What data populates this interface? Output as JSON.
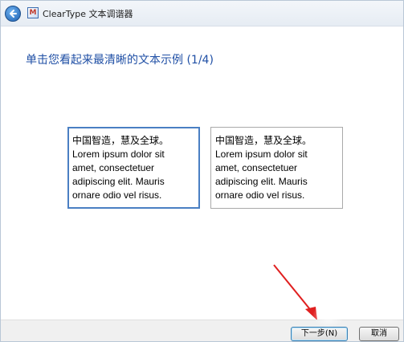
{
  "window": {
    "title": "ClearType 文本调谐器",
    "app_icon_glyph": "M"
  },
  "instruction": "单击您看起来最清晰的文本示例 (1/4)",
  "samples": [
    {
      "text": "中国智造，慧及全球。\nLorem ipsum dolor sit\namet, consectetuer\nadipiscing elit. Mauris\nornare odio vel risus.",
      "selected": true
    },
    {
      "text": "中国智造，慧及全球。\nLorem ipsum dolor sit\namet, consectetuer\nadipiscing elit. Mauris\nornare odio vel risus.",
      "selected": false
    }
  ],
  "footer": {
    "next_label": "下一步(N)",
    "cancel_label": "取消"
  },
  "icons": {
    "back": "back-arrow-icon",
    "app": "cleartype-app-icon",
    "annotation": "red-arrow-annotation"
  },
  "colors": {
    "instruction": "#1f4fa5",
    "selected_border": "#4a7fc3",
    "annotation_arrow": "#e02020"
  }
}
